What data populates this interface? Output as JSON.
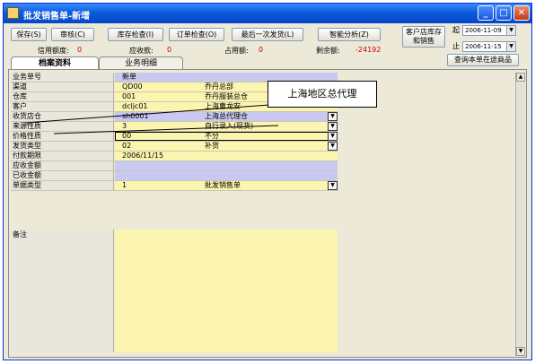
{
  "window": {
    "title": "批发销售单-新增"
  },
  "toolbar": {
    "save": "保存(S)",
    "review": "审核(C)",
    "stock_check": "库存检查(I)",
    "order_check": "订单检查(O)",
    "last_ship": "最后一次发货(L)",
    "smart_analysis": "智能分析(Z)",
    "store_stock_sales": "客户店库存和销售",
    "in_transit": "查询本单在途商品"
  },
  "summary": {
    "credit_label": "信用额度:",
    "credit_value": "0",
    "receivable_label": "应收款:",
    "receivable_value": "0",
    "used_label": "占用额:",
    "used_value": "0",
    "remaining_label": "剩余额:",
    "remaining_value": "-24192"
  },
  "dates": {
    "from_label": "起",
    "from_value": "2006-11-09",
    "to_label": "止",
    "to_value": "2006-11-15"
  },
  "tabs": [
    {
      "label": "档案资料"
    },
    {
      "label": "业务明细"
    }
  ],
  "grid": {
    "rows": [
      {
        "label": "业务单号",
        "v1": "新单",
        "v2": ""
      },
      {
        "label": "渠道",
        "v1": "QD00",
        "v2": "乔丹总部"
      },
      {
        "label": "仓库",
        "v1": "001",
        "v2": "乔丹服装总仓"
      },
      {
        "label": "客户",
        "v1": "dcljc01",
        "v2": "上海曹龙安"
      },
      {
        "label": "收货店仓",
        "v1": "sh0001",
        "v2": "上海总代理仓"
      },
      {
        "label": "来源性质",
        "v1": "3",
        "v2": "自行录入(现货)"
      },
      {
        "label": "价格性质",
        "v1": "00",
        "v2": "不分"
      },
      {
        "label": "发货类型",
        "v1": "02",
        "v2": "补货"
      },
      {
        "label": "付款期限",
        "v1": "2006/11/15",
        "v2": ""
      },
      {
        "label": "应收金额",
        "v1": "",
        "v2": ""
      },
      {
        "label": "已收金额",
        "v1": "",
        "v2": ""
      },
      {
        "label": "单据类型",
        "v1": "1",
        "v2": "批发销售单"
      }
    ],
    "memo_label": "备注"
  },
  "callout": {
    "text": "上海地区总代理"
  },
  "icons": {
    "dropdown": "▼",
    "scroll_up": "▲",
    "scroll_down": "▼",
    "minimize": "_",
    "maximize": "□",
    "close": "✕"
  },
  "colors": {
    "title_blue": "#0a5bdc",
    "field_yellow": "#fbf5b0",
    "field_lilac": "#c8c8f0",
    "negative_red": "#d00000"
  }
}
